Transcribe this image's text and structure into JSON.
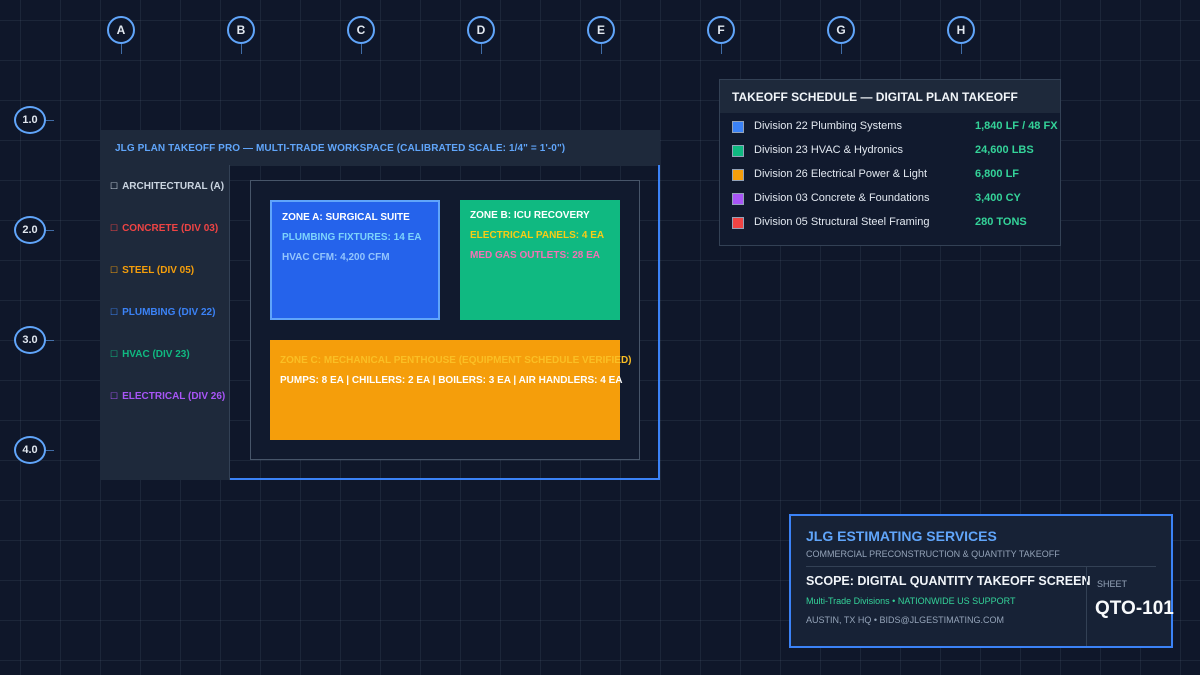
{
  "grid": {
    "columns": [
      "A",
      "B",
      "C",
      "D",
      "E",
      "F",
      "G",
      "H"
    ],
    "rows": [
      "1.0",
      "2.0",
      "3.0",
      "4.0"
    ]
  },
  "workspace": {
    "title": "JLG PLAN TAKEOFF PRO — MULTI-TRADE WORKSPACE (CALIBRATED SCALE: 1/4\" = 1'-0\")",
    "checkbox_glyph": "☐",
    "layers": [
      {
        "label": "ARCHITECTURAL (A)",
        "color": "#cbd5e1"
      },
      {
        "label": "CONCRETE (DIV 03)",
        "color": "#ef4444"
      },
      {
        "label": "STEEL (DIV 05)",
        "color": "#f59e0b"
      },
      {
        "label": "PLUMBING (DIV 22)",
        "color": "#3b82f6"
      },
      {
        "label": "HVAC (DIV 23)",
        "color": "#10b981"
      },
      {
        "label": "ELECTRICAL (DIV 26)",
        "color": "#a855f7"
      }
    ],
    "zones": {
      "a": {
        "title": "ZONE A: SURGICAL SUITE",
        "line1": "PLUMBING FIXTURES: 14 EA",
        "line2": "HVAC CFM: 4,200 CFM"
      },
      "b": {
        "title": "ZONE B: ICU RECOVERY",
        "line1": "ELECTRICAL PANELS: 4 EA",
        "line2": "MED GAS OUTLETS: 28 EA"
      },
      "c": {
        "title": "ZONE C: MECHANICAL PENTHOUSE (EQUIPMENT SCHEDULE VERIFIED)",
        "line1": "PUMPS: 8 EA | CHILLERS: 2 EA | BOILERS: 3 EA | AIR HANDLERS: 4 EA"
      }
    }
  },
  "schedule": {
    "title": "TAKEOFF SCHEDULE — DIGITAL PLAN TAKEOFF",
    "rows": [
      {
        "division": "Division 22 Plumbing Systems",
        "quantity": "1,840 LF / 48 FX",
        "color": "#3b82f6"
      },
      {
        "division": "Division 23 HVAC & Hydronics",
        "quantity": "24,600 LBS",
        "color": "#10b981"
      },
      {
        "division": "Division 26 Electrical Power & Light",
        "quantity": "6,800 LF",
        "color": "#f59e0b"
      },
      {
        "division": "Division 03 Concrete & Foundations",
        "quantity": "3,400 CY",
        "color": "#a855f7"
      },
      {
        "division": "Division 05 Structural Steel Framing",
        "quantity": "280 TONS",
        "color": "#ef4444"
      }
    ]
  },
  "title_block": {
    "company": "JLG ESTIMATING SERVICES",
    "tagline": "COMMERCIAL PRECONSTRUCTION & QUANTITY TAKEOFF",
    "scope": "SCOPE: DIGITAL QUANTITY TAKEOFF SCREEN",
    "support": "Multi-Trade Divisions • NATIONWIDE US SUPPORT",
    "address": "AUSTIN, TX HQ • BIDS@JLGESTIMATING.COM",
    "sheet_label": "SHEET",
    "sheet_number": "QTO-101"
  }
}
